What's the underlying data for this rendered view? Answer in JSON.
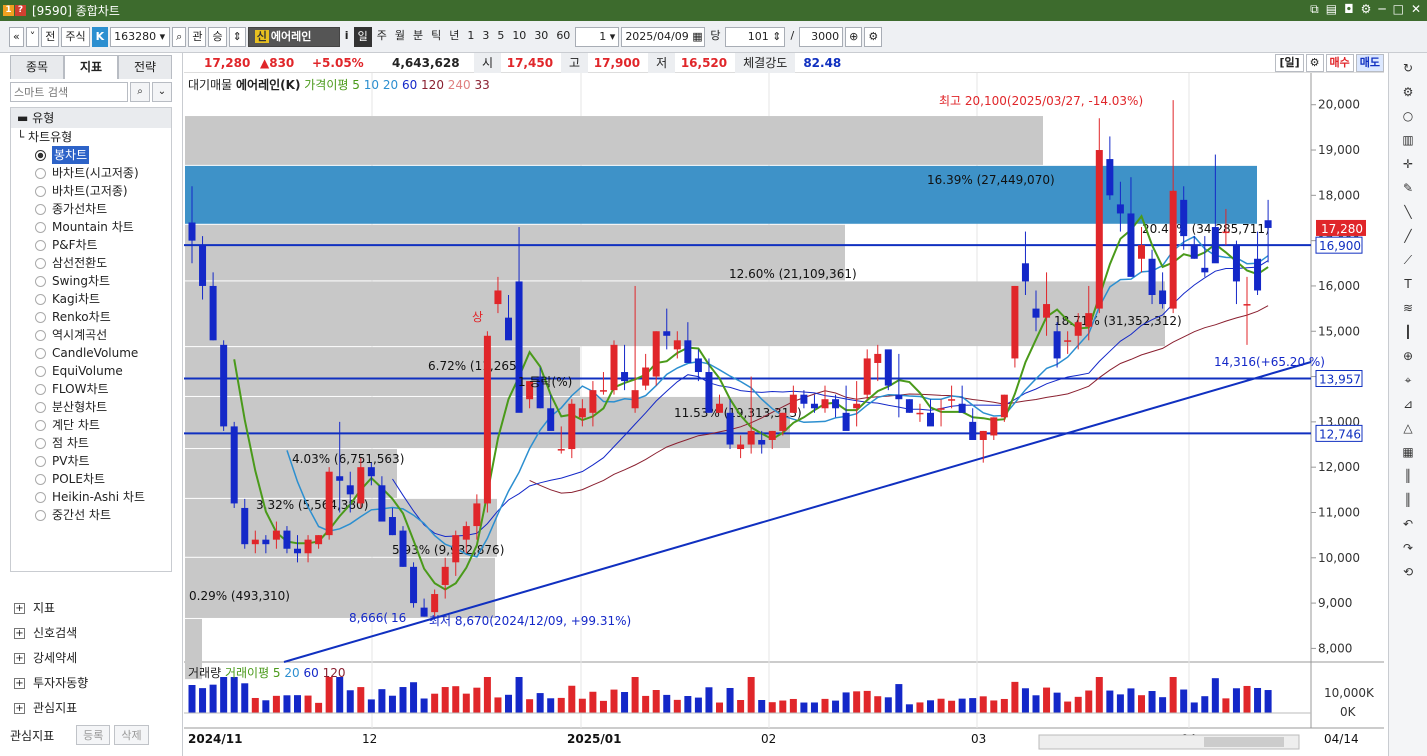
{
  "window": {
    "title": "[9590] 종합차트"
  },
  "toolbar": {
    "nav_prev": "«",
    "nav_down": "˅",
    "jeon": "전",
    "jusik": "주식",
    "k_badge": "K",
    "code": "163280",
    "gwan": "관",
    "seung": "승",
    "stock_prefix": "신",
    "stock_name": "에어레인",
    "info": "i",
    "periods": [
      "일",
      "주",
      "월",
      "분",
      "틱",
      "년"
    ],
    "period_selected": "일",
    "intervals": [
      "1",
      "3",
      "5",
      "10",
      "30",
      "60"
    ],
    "interval_value": "1",
    "date": "2025/04/09",
    "dang": "당",
    "count": "101",
    "slash": "/",
    "total": "3000"
  },
  "quote": {
    "price": "17,280",
    "change": "▲830",
    "change_pct": "+5.05%",
    "volume": "4,643,628",
    "open_label": "시",
    "open": "17,450",
    "high_label": "고",
    "high": "17,900",
    "low_label": "저",
    "low": "16,520",
    "strength_label": "체결강도",
    "strength": "82.48",
    "period_btn": "[일]",
    "buy_btn": "매수",
    "sell_btn": "매도"
  },
  "left": {
    "tabs": [
      "종목",
      "지표",
      "전략"
    ],
    "active_tab": "지표",
    "search_placeholder": "스마트 검색",
    "type_category": "유형",
    "chart_type_header": "차트유형",
    "chart_types": [
      "봉차트",
      "바차트(시고저종)",
      "바차트(고저종)",
      "종가선차트",
      "Mountain 차트",
      "P&F차트",
      "삼선전환도",
      "Swing차트",
      "Kagi차트",
      "Renko차트",
      "역시계곡선",
      "CandleVolume",
      "EquiVolume",
      "FLOW차트",
      "분산형차트",
      "계단 차트",
      "점 차트",
      "PV차트",
      "POLE차트",
      "Heikin-Ashi 차트",
      "중간선 차트"
    ],
    "selected_type": "봉차트",
    "groups": [
      "지표",
      "신호검색",
      "강세약세",
      "투자자동향",
      "관심지표"
    ],
    "bottom_label": "관심지표",
    "register_btn": "등록",
    "delete_btn": "삭제"
  },
  "chart": {
    "legend": {
      "a": "대기매물",
      "b": "에어레인(K)",
      "c": "가격이평 5",
      "d": "10",
      "e": "20",
      "f": "60",
      "g": "120",
      "h": "240",
      "i": "33"
    },
    "vol_legend": {
      "a": "거래량",
      "b": "거래이평 5",
      "c": "20",
      "d": "60",
      "e": "120"
    },
    "annotations": {
      "high": "최고 20,100(2025/03/27, -14.03%)",
      "low": "최저 8,670(2024/12/09, +99.31%)",
      "trend_left": "8,666(",
      "trend_left2": "16",
      "trend_right": "14,316(+65.20 %)",
      "sang": "상"
    },
    "price_ticks": [
      "20,000",
      "19,000",
      "18,000",
      "17,000",
      "16,000",
      "15,000",
      "14,000",
      "13,000",
      "12,000",
      "11,000",
      "10,000",
      "9,000",
      "8,000"
    ],
    "vol_ticks": [
      "10,000K",
      "0K"
    ],
    "price_tag": "17,280",
    "hline_tags": [
      "16,900",
      "13,957",
      "12,746"
    ],
    "date_labels": [
      "2024/11",
      "12",
      "2025/01",
      "02",
      "03",
      "04",
      "04/14"
    ],
    "profile_labels": [
      "16.39% (27,449,070)",
      "20.47% (34,285,711)",
      "12.60% (21,109,361)",
      "18.71% (31,352,312)",
      "6.72% (11,265",
      "11.53% (19,313,313)",
      "4.03% (6,751,563)",
      "3.32% (5,564,380)",
      "5.93% (9,932,876)",
      "0.29% (493,310)"
    ],
    "mid_label": "1 등락(%)"
  },
  "chart_data": {
    "type": "candlestick",
    "ylim": [
      7700,
      20700
    ],
    "candles": [
      [
        17400,
        18200,
        16500,
        17000
      ],
      [
        16900,
        17100,
        15700,
        16000
      ],
      [
        16000,
        16300,
        14800,
        14800
      ],
      [
        14700,
        14800,
        12800,
        12900
      ],
      [
        12900,
        13000,
        11100,
        11200
      ],
      [
        11100,
        11300,
        10200,
        10300
      ],
      [
        10300,
        10600,
        10100,
        10400
      ],
      [
        10400,
        10500,
        10100,
        10300
      ],
      [
        10400,
        10800,
        10200,
        10600
      ],
      [
        10600,
        10700,
        10100,
        10200
      ],
      [
        10200,
        10500,
        9900,
        10100
      ],
      [
        10100,
        10500,
        9900,
        10400
      ],
      [
        10300,
        10500,
        10200,
        10500
      ],
      [
        10500,
        12000,
        10400,
        11900
      ],
      [
        11800,
        13000,
        11000,
        11700
      ],
      [
        11600,
        11900,
        11000,
        11400
      ],
      [
        11200,
        12200,
        11100,
        12000
      ],
      [
        12000,
        12100,
        11600,
        11800
      ],
      [
        11600,
        11800,
        10900,
        10800
      ],
      [
        10900,
        11100,
        10500,
        10500
      ],
      [
        10600,
        10700,
        9800,
        9800
      ],
      [
        9800,
        9900,
        8900,
        9000
      ],
      [
        8900,
        9100,
        8700,
        8700
      ],
      [
        8800,
        9300,
        8700,
        9200
      ],
      [
        9400,
        10000,
        9100,
        9800
      ],
      [
        9900,
        10600,
        9600,
        10500
      ],
      [
        10400,
        10800,
        10100,
        10700
      ],
      [
        10700,
        11400,
        10400,
        11200
      ],
      [
        11200,
        15000,
        11000,
        14900
      ],
      [
        15600,
        16200,
        15400,
        15900
      ],
      [
        15300,
        15800,
        14900,
        14800
      ],
      [
        16100,
        17300,
        15000,
        13200
      ],
      [
        13500,
        13900,
        13300,
        13900
      ],
      [
        14000,
        14200,
        13300,
        13300
      ],
      [
        13300,
        13600,
        13000,
        12800
      ],
      [
        12400,
        12900,
        12300,
        12400
      ],
      [
        12400,
        13500,
        12200,
        13400
      ],
      [
        13100,
        13500,
        12900,
        13300
      ],
      [
        13200,
        13900,
        12900,
        13700
      ],
      [
        13700,
        14100,
        13600,
        13700
      ],
      [
        13700,
        14800,
        13600,
        14700
      ],
      [
        14100,
        14700,
        13700,
        13900
      ],
      [
        13300,
        16000,
        13200,
        13700
      ],
      [
        13800,
        14500,
        13700,
        14200
      ],
      [
        14000,
        15000,
        13800,
        15000
      ],
      [
        15000,
        15500,
        14600,
        14900
      ],
      [
        14600,
        15000,
        14400,
        14800
      ],
      [
        14800,
        15200,
        14400,
        14300
      ],
      [
        14400,
        14600,
        13900,
        14100
      ],
      [
        14100,
        14400,
        13200,
        13200
      ],
      [
        13200,
        13600,
        13200,
        13400
      ],
      [
        13200,
        13500,
        12400,
        12500
      ],
      [
        12400,
        12700,
        12200,
        12500
      ],
      [
        12500,
        14000,
        12300,
        12800
      ],
      [
        12600,
        12800,
        12300,
        12500
      ],
      [
        12600,
        12800,
        12400,
        12800
      ],
      [
        12800,
        13200,
        12700,
        13200
      ],
      [
        13200,
        13800,
        13200,
        13600
      ],
      [
        13600,
        13700,
        13300,
        13400
      ],
      [
        13400,
        13600,
        13200,
        13300
      ],
      [
        13300,
        13800,
        13200,
        13500
      ],
      [
        13500,
        13600,
        13100,
        13300
      ],
      [
        13200,
        13800,
        12900,
        12800
      ],
      [
        13300,
        13900,
        12900,
        13400
      ],
      [
        13600,
        14600,
        13500,
        14400
      ],
      [
        14300,
        14700,
        13900,
        14500
      ],
      [
        14600,
        14400,
        13700,
        13800
      ],
      [
        13600,
        14500,
        13100,
        13500
      ],
      [
        13500,
        13500,
        13200,
        13200
      ],
      [
        13200,
        13400,
        13000,
        13200
      ],
      [
        13200,
        13500,
        13000,
        12900
      ],
      [
        13300,
        13500,
        12900,
        13300
      ],
      [
        13500,
        13800,
        13300,
        13500
      ],
      [
        13400,
        13800,
        13200,
        13200
      ],
      [
        13000,
        13300,
        12700,
        12600
      ],
      [
        12600,
        12800,
        12100,
        12800
      ],
      [
        12700,
        13100,
        12600,
        13100
      ],
      [
        13100,
        13600,
        13000,
        13600
      ],
      [
        14400,
        16000,
        14200,
        16000
      ],
      [
        16500,
        17200,
        15800,
        16100
      ],
      [
        15500,
        15900,
        15000,
        15300
      ],
      [
        15300,
        16300,
        14900,
        15600
      ],
      [
        15000,
        15200,
        14200,
        14400
      ],
      [
        14800,
        15000,
        14500,
        14800
      ],
      [
        14900,
        15400,
        14600,
        15200
      ],
      [
        15100,
        16000,
        14800,
        15400
      ],
      [
        15500,
        19700,
        15400,
        19000
      ],
      [
        18800,
        19300,
        17900,
        18000
      ],
      [
        17800,
        18300,
        17200,
        17600
      ],
      [
        17600,
        18400,
        17000,
        16200
      ],
      [
        16600,
        17300,
        16300,
        16900
      ],
      [
        16600,
        16800,
        15600,
        15800
      ],
      [
        15900,
        16300,
        15500,
        15600
      ],
      [
        15500,
        20100,
        15400,
        18100
      ],
      [
        17900,
        18200,
        16800,
        17100
      ],
      [
        16900,
        17100,
        16600,
        16600
      ],
      [
        16400,
        17100,
        16200,
        16300
      ],
      [
        17300,
        18900,
        16800,
        16500
      ],
      [
        17200,
        17700,
        16900,
        17200
      ],
      [
        16900,
        17000,
        15600,
        16100
      ],
      [
        15600,
        16200,
        14700,
        15600
      ],
      [
        16600,
        17200,
        15800,
        15900
      ],
      [
        17450,
        17900,
        16520,
        17280
      ]
    ]
  },
  "colors": {
    "up": "#e0262a",
    "down": "#1428c8",
    "ma5": "#4a9a1a",
    "hline": "#1030c0",
    "profile": "#c8c8c8",
    "profile_hi": "#3e92c8"
  }
}
